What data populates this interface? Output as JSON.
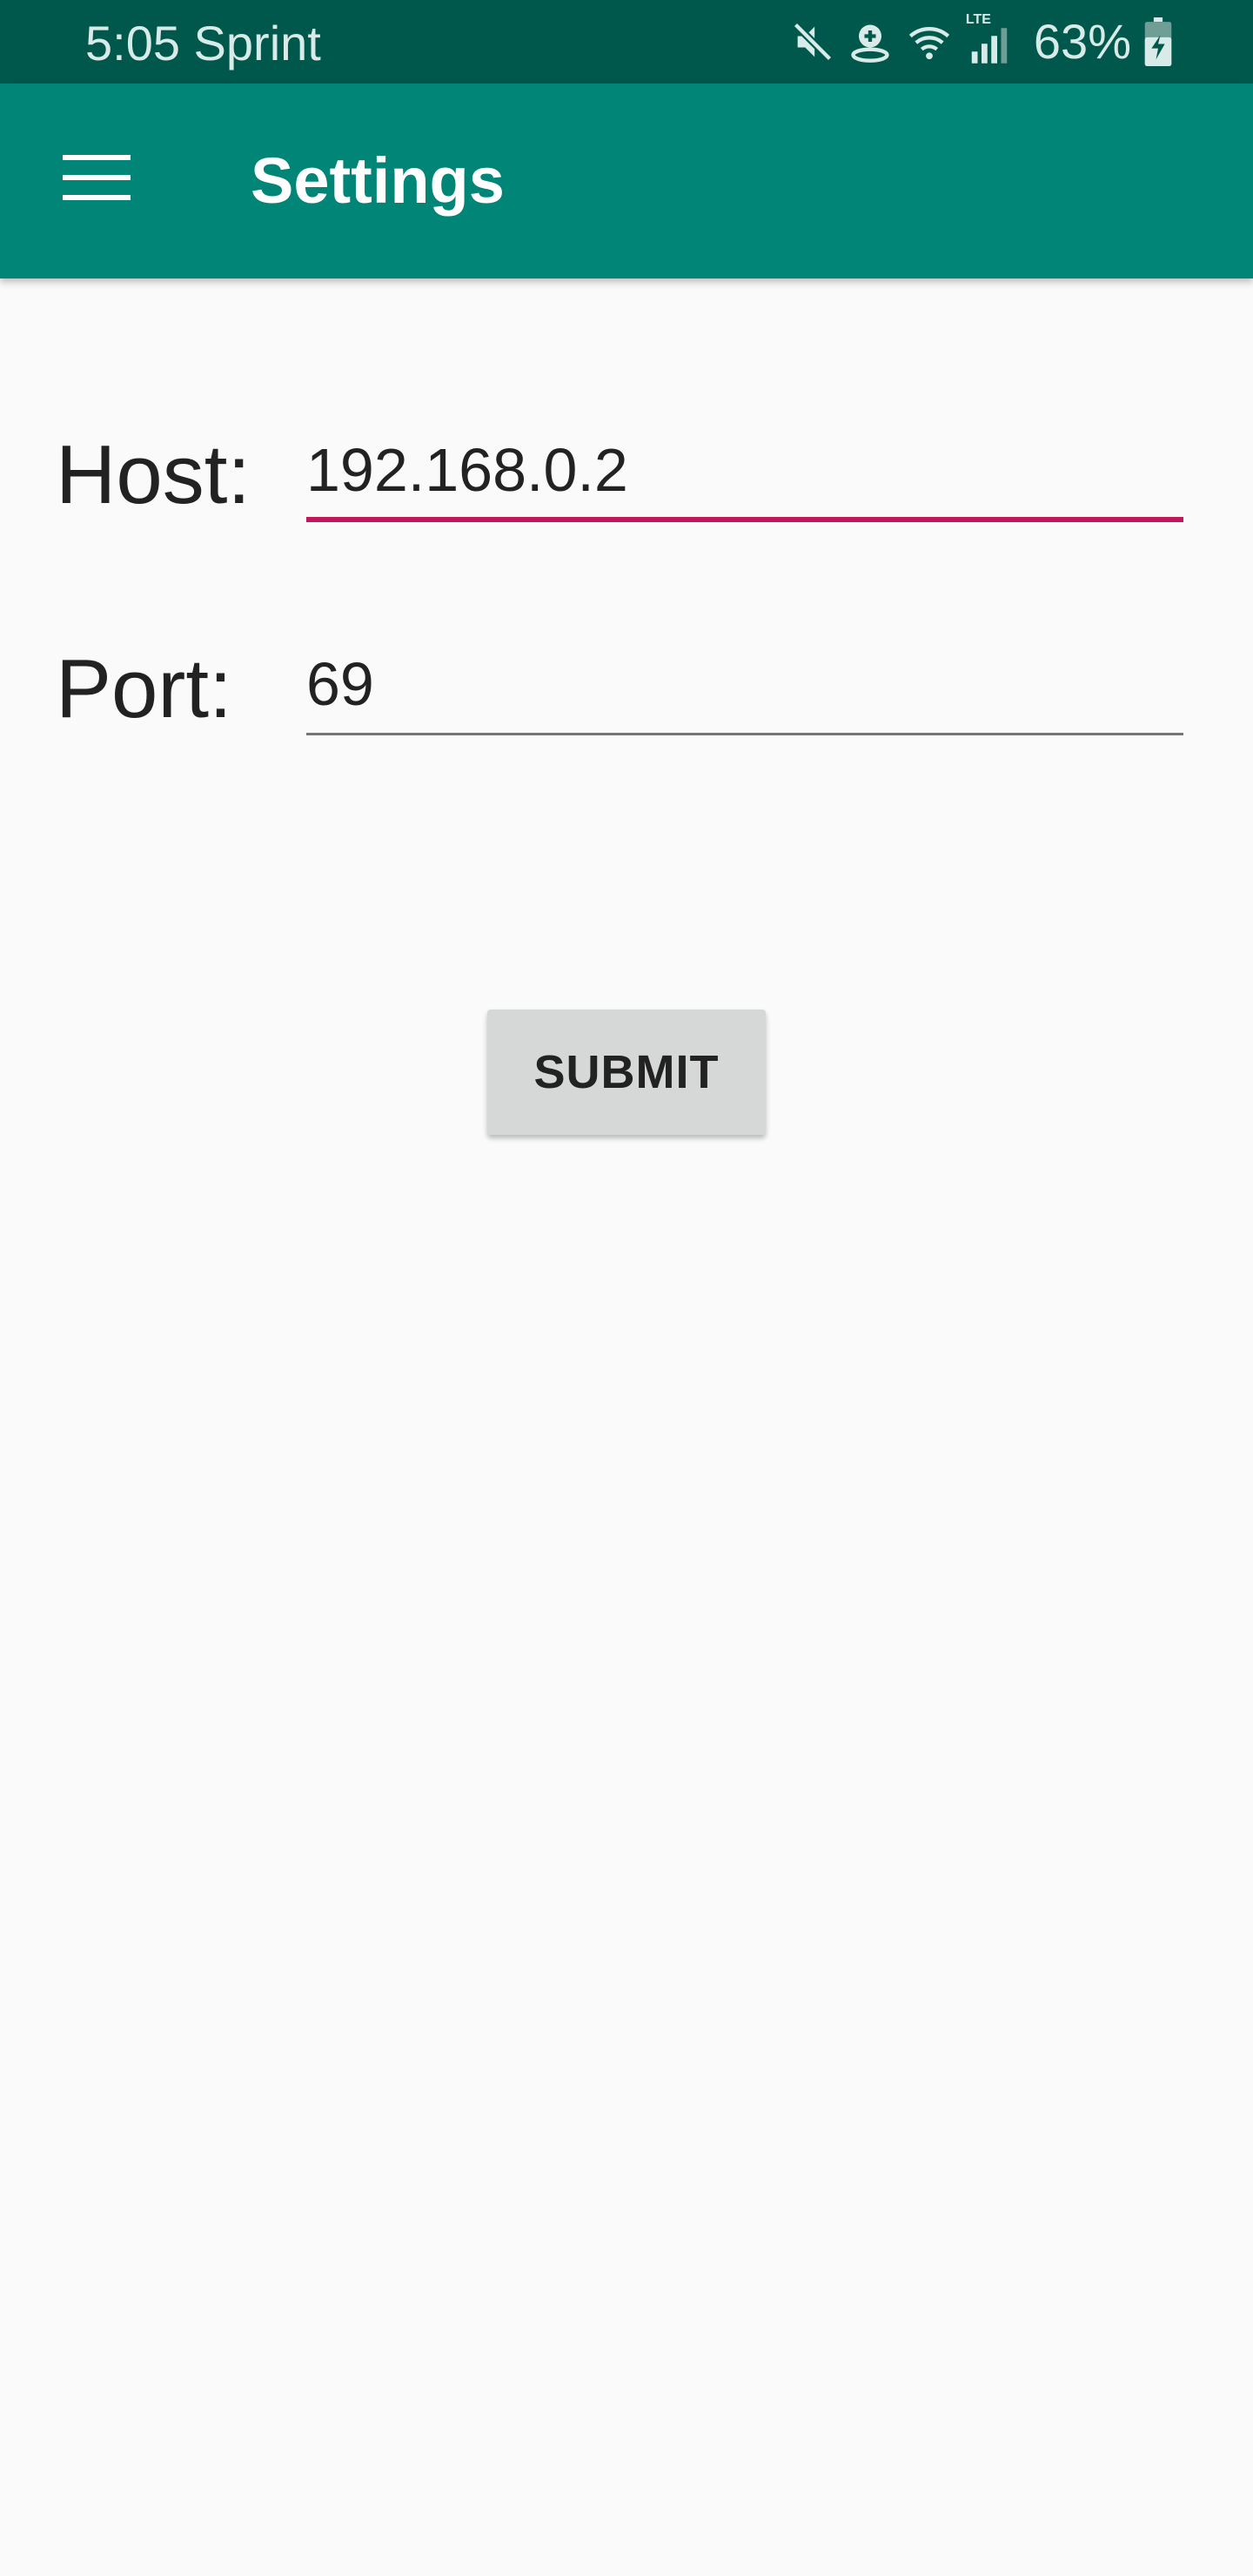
{
  "status_bar": {
    "time_carrier": "5:05 Sprint",
    "battery": "63%",
    "icons": [
      "mute-icon",
      "location-icon",
      "wifi-icon",
      "lte-signal-icon",
      "battery-charging-icon"
    ],
    "lte_label": "LTE",
    "background_color": "#00574b"
  },
  "app_bar": {
    "title": "Settings",
    "menu_icon": "hamburger-menu-icon",
    "background_color": "#008577"
  },
  "form": {
    "host": {
      "label": "Host:",
      "value": "192.168.0.2",
      "focused": true,
      "underline_color": "#c2185b"
    },
    "port": {
      "label": "Port:",
      "value": "69",
      "focused": false,
      "underline_color": "#757575"
    },
    "submit_label": "SUBMIT"
  }
}
